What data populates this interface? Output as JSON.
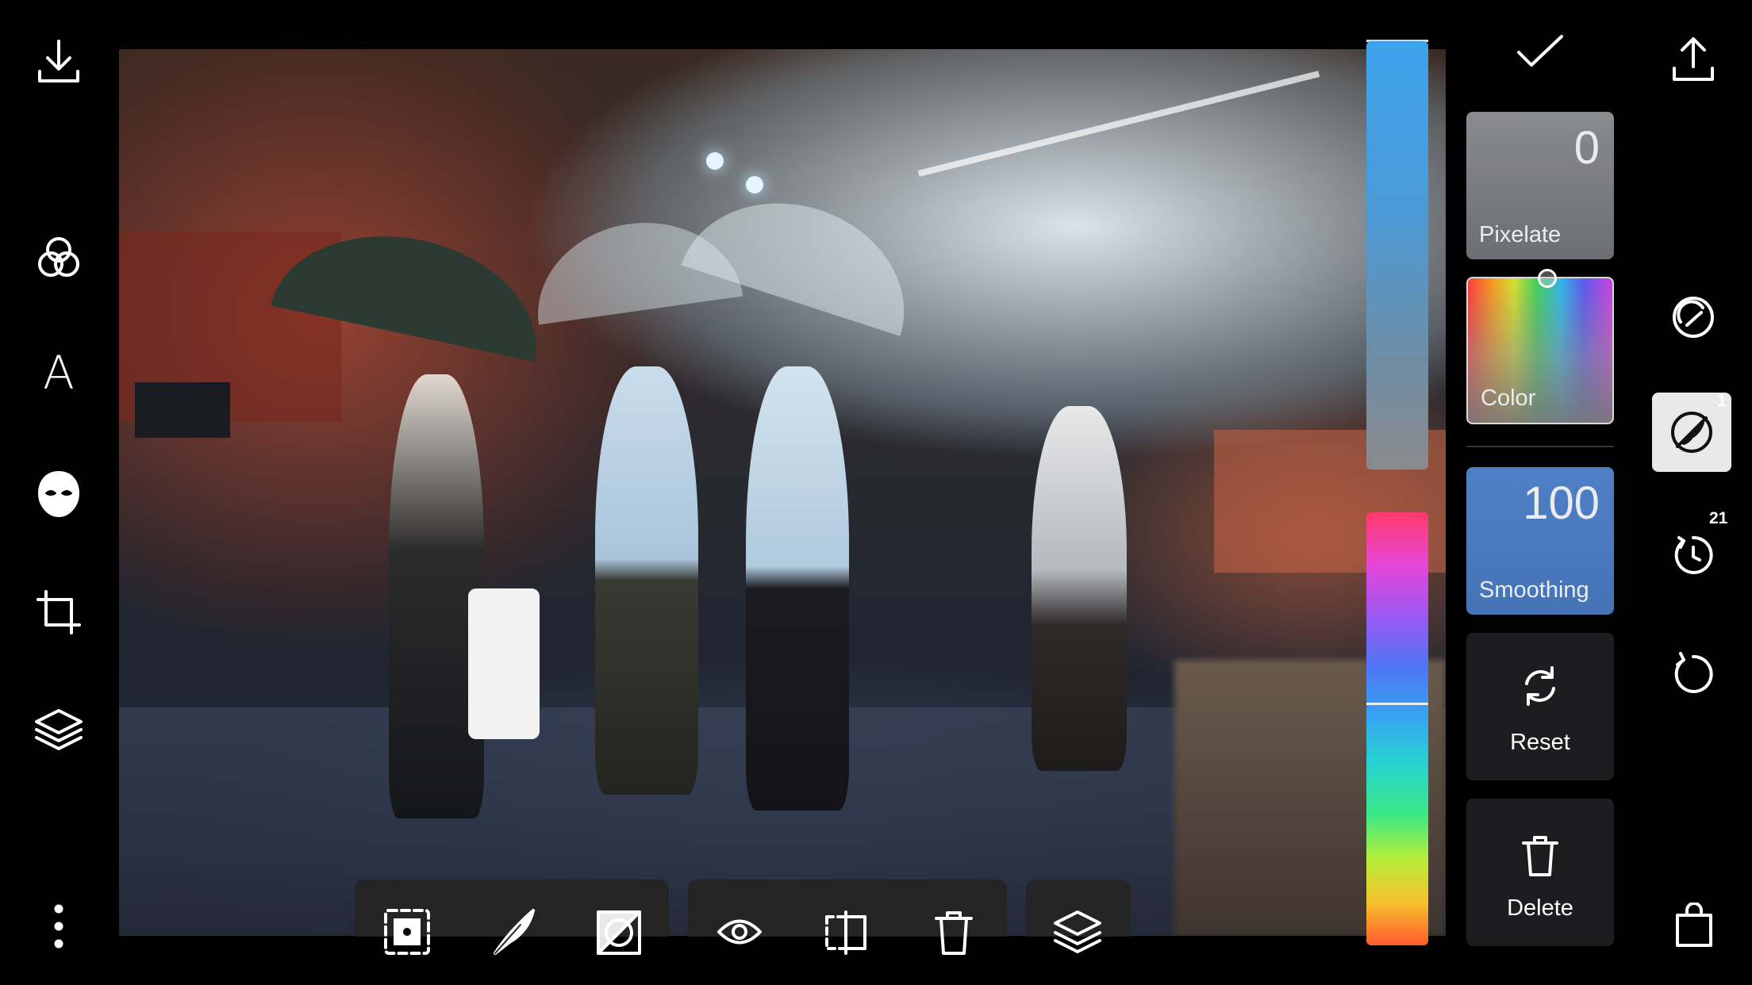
{
  "app": {
    "name": "photo-editor"
  },
  "left_toolbar": {
    "items": [
      {
        "name": "download",
        "icon": "download-icon"
      },
      {
        "name": "filters",
        "icon": "filters-icon"
      },
      {
        "name": "text",
        "icon": "text-icon",
        "label": "A"
      },
      {
        "name": "face",
        "icon": "face-mask-icon"
      },
      {
        "name": "crop",
        "icon": "crop-icon"
      },
      {
        "name": "layers",
        "icon": "layers-icon"
      },
      {
        "name": "more",
        "icon": "more-vertical-icon",
        "label": "⋮"
      }
    ]
  },
  "right_toolbar": {
    "items": [
      {
        "name": "share",
        "icon": "share-icon"
      },
      {
        "name": "retouch",
        "icon": "retouch-icon"
      },
      {
        "name": "pixelate-tool",
        "icon": "no-brush-icon",
        "badge": "1",
        "selected": true
      },
      {
        "name": "history",
        "icon": "history-icon",
        "badge": "21"
      },
      {
        "name": "undo",
        "icon": "undo-icon"
      },
      {
        "name": "shop",
        "icon": "shopping-bag-icon"
      }
    ]
  },
  "confirm": {
    "icon": "checkmark-icon"
  },
  "panel": {
    "pixelate": {
      "value": "0",
      "label": "Pixelate"
    },
    "color": {
      "label": "Color"
    },
    "smoothing": {
      "value": "100",
      "label": "Smoothing"
    },
    "reset": {
      "label": "Reset",
      "icon": "refresh-icon"
    },
    "delete": {
      "label": "Delete",
      "icon": "trash-icon"
    }
  },
  "sliders": {
    "top": {
      "colors": [
        "#3fa2ec",
        "#8a8a8c"
      ]
    },
    "bottom": {
      "colors": [
        "#ff3a6a",
        "#e646d8",
        "#4d77f4",
        "#25d4d0",
        "#3de884",
        "#f5c22c",
        "#ff5a2c"
      ]
    }
  },
  "bottom_toolbar": {
    "groups": [
      {
        "items": [
          "select-region-icon",
          "feather-icon",
          "mask-toggle-icon"
        ]
      },
      {
        "items": [
          "eye-icon",
          "split-icon",
          "trash-icon"
        ]
      },
      {
        "items": [
          "layers-icon"
        ]
      }
    ]
  },
  "colors": {
    "background": "#000000",
    "smoothing_card": "#4f7fc6",
    "pixelate_card": "#7d7e81",
    "selected_tool": "#e9e9e9"
  }
}
